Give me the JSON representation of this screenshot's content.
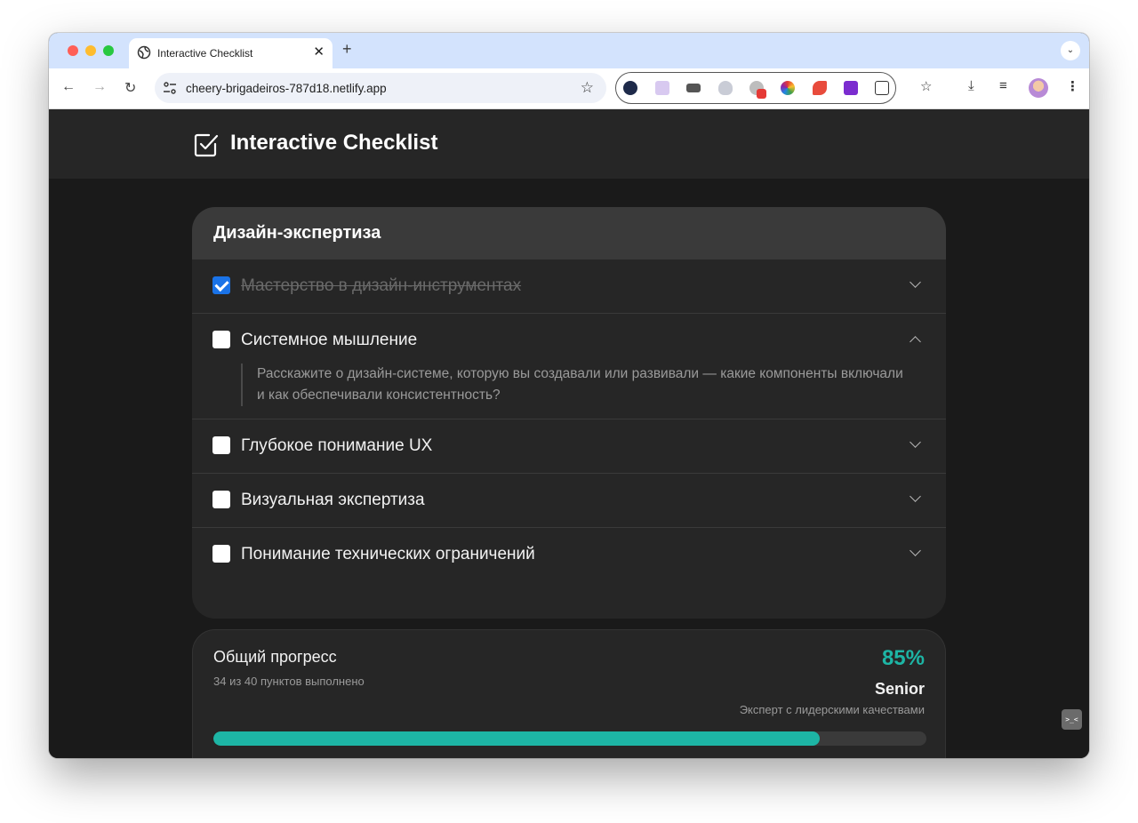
{
  "browser": {
    "tab_title": "Interactive Checklist",
    "new_tab": "+",
    "close_tab": "✕",
    "url": "cheery-brigadeiros-787d18.netlify.app"
  },
  "app": {
    "title": "Interactive Checklist"
  },
  "section": {
    "title": "Дизайн-экспертиза",
    "items": [
      {
        "label": "Мастерство в дизайн-инструментах",
        "checked": true,
        "expanded": false
      },
      {
        "label": "Системное мышление",
        "checked": false,
        "expanded": true,
        "detail": "Расскажите о дизайн-системе, которую вы создавали или развивали — какие компоненты включали и как обеспечивали консистентность?"
      },
      {
        "label": "Глубокое понимание UX",
        "checked": false,
        "expanded": false
      },
      {
        "label": "Визуальная экспертиза",
        "checked": false,
        "expanded": false
      },
      {
        "label": "Понимание технических ограничений",
        "checked": false,
        "expanded": false
      }
    ]
  },
  "progress": {
    "title": "Общий прогресс",
    "summary": "34 из 40 пунктов выполнено",
    "percent_label": "85%",
    "percent": 85,
    "level": "Senior",
    "level_desc": "Эксперт с лидерскими качествами"
  },
  "colors": {
    "accent": "#1db5a5",
    "checkbox_checked": "#1a73e8"
  }
}
